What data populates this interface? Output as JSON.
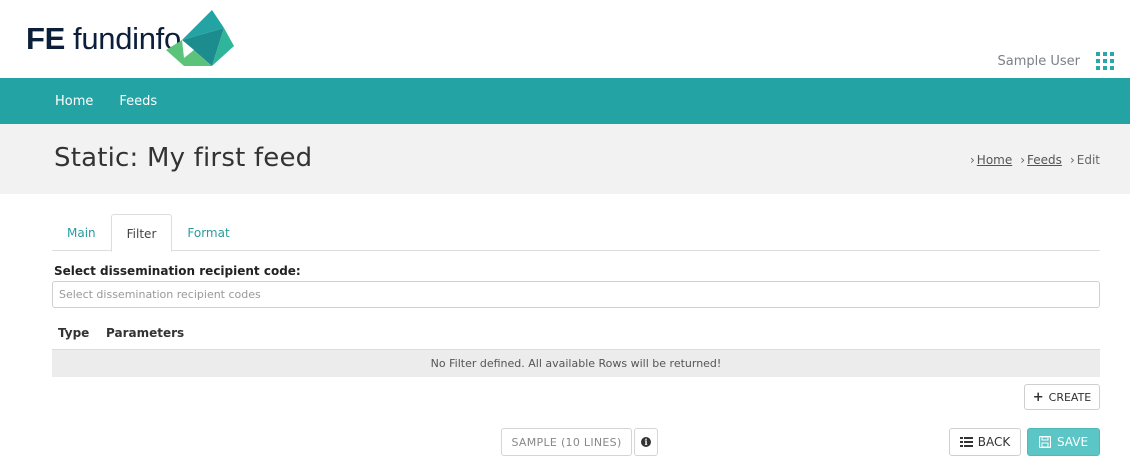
{
  "brand": {
    "logo_prefix": "FE",
    "logo_name": "fundinfo",
    "accent_color": "#23a3a3"
  },
  "header": {
    "user_name": "Sample User",
    "apps_icon": "apps-grid-icon"
  },
  "nav": {
    "items": [
      {
        "label": "Home"
      },
      {
        "label": "Feeds"
      }
    ]
  },
  "page": {
    "title": "Static: My first feed",
    "breadcrumb": [
      {
        "label": "Home",
        "link": true
      },
      {
        "label": "Feeds",
        "link": true
      },
      {
        "label": "Edit",
        "link": false
      }
    ]
  },
  "tabs": [
    {
      "label": "Main",
      "active": false
    },
    {
      "label": "Filter",
      "active": true
    },
    {
      "label": "Format",
      "active": false
    }
  ],
  "filter": {
    "recipient_label": "Select dissemination recipient code:",
    "recipient_placeholder": "Select dissemination recipient codes",
    "recipient_value": "",
    "table_headers": [
      "Type",
      "Parameters"
    ],
    "empty_message": "No Filter defined. All available Rows will be returned!",
    "create_label": "CREATE"
  },
  "footer": {
    "sample_label": "SAMPLE (10 LINES)",
    "back_label": "BACK",
    "save_label": "SAVE"
  }
}
